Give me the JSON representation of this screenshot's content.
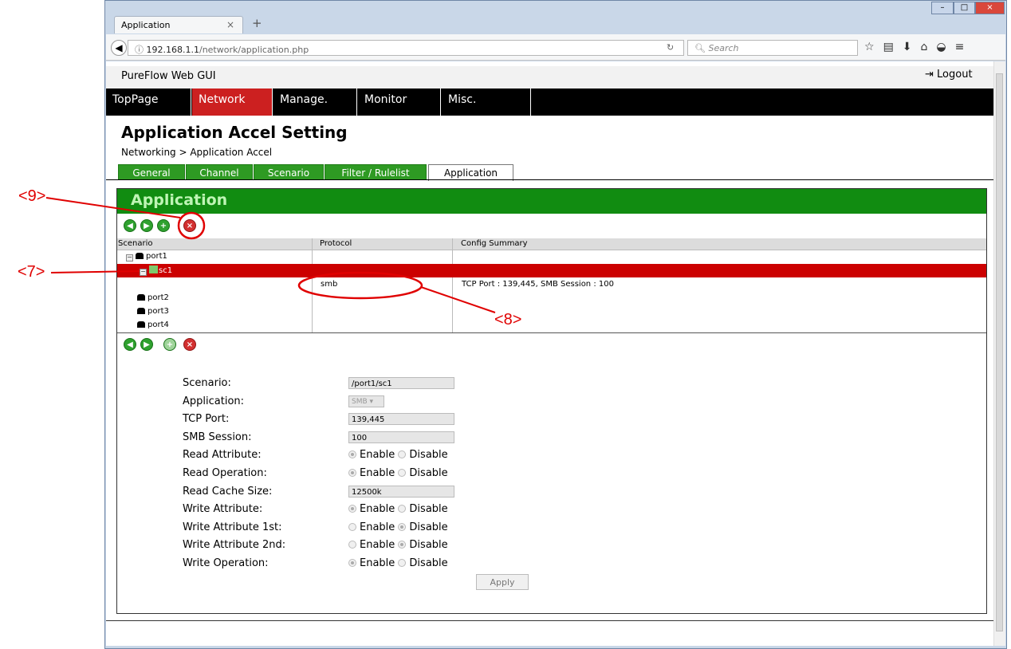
{
  "browser": {
    "tab_title": "Application",
    "tab_close": "×",
    "new_tab": "+",
    "url_host": "192.168.1.1",
    "url_path": "/network/application.php",
    "search_placeholder": "Search"
  },
  "app": {
    "title": "PureFlow Web GUI",
    "logout_label": "Logout"
  },
  "menu": [
    "TopPage",
    "Network",
    "Manage.",
    "Monitor",
    "Misc."
  ],
  "menu_active": "Network",
  "page": {
    "title": "Application Accel Setting",
    "breadcrumb": "Networking > Application Accel"
  },
  "subtabs": [
    "General",
    "Channel",
    "Scenario",
    "Filter / Rulelist",
    "Application"
  ],
  "subtab_active": "Application",
  "panel": {
    "title": "Application"
  },
  "tree": {
    "columns": [
      "Scenario",
      "Protocol",
      "Config Summary"
    ],
    "rows": {
      "port1": "port1",
      "sc1": "sc1",
      "app_protocol": "smb",
      "app_summary": "TCP Port : 139,445, SMB Session : 100",
      "port2": "port2",
      "port3": "port3",
      "port4": "port4"
    }
  },
  "form": {
    "labels": {
      "scenario": "Scenario:",
      "application": "Application:",
      "tcp_port": "TCP Port:",
      "smb_session": "SMB Session:",
      "read_attribute": "Read Attribute:",
      "read_operation": "Read Operation:",
      "read_cache_size": "Read Cache Size:",
      "write_attribute": "Write Attribute:",
      "write_attribute_1st": "Write Attribute 1st:",
      "write_attribute_2nd": "Write Attribute 2nd:",
      "write_operation": "Write Operation:"
    },
    "values": {
      "scenario": "/port1/sc1",
      "application": "SMB",
      "tcp_port": "139,445",
      "smb_session": "100",
      "read_cache_size": "12500k"
    },
    "radio_enable": "Enable",
    "radio_disable": "Disable",
    "radio_states": {
      "read_attribute": "Enable",
      "read_operation": "Enable",
      "write_attribute": "Enable",
      "write_attribute_1st": "Disable",
      "write_attribute_2nd": "Disable",
      "write_operation": "Enable"
    },
    "apply_label": "Apply"
  },
  "annotations": {
    "a9": "<9>",
    "a7": "<7>",
    "a8": "<8>"
  },
  "colors": {
    "menu_active": "#cc2020",
    "panel_header": "#118c11",
    "panel_title": "#bff5b5",
    "subtab": "#2e9a23",
    "selected_row": "#cc0000",
    "annotation": "#e00000"
  },
  "icons": {
    "toolbar": [
      "arrow-left-icon",
      "arrow-right-icon",
      "add-icon",
      "delete-icon"
    ]
  }
}
